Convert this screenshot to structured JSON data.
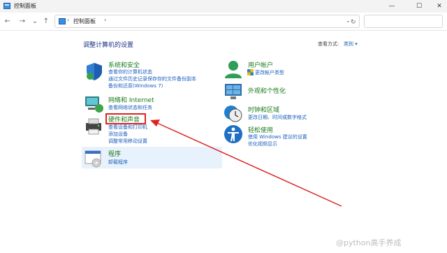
{
  "window": {
    "title": "控制面板",
    "minimize": "—",
    "maximize": "☐",
    "close": "✕"
  },
  "nav": {
    "back": "←",
    "forward": "→",
    "recent": "⌄",
    "up": "↑",
    "address": "控制面板",
    "address_sep": "›",
    "address_after": "›",
    "chevron": "⌄",
    "refresh": "↻",
    "search_placeholder": ""
  },
  "heading": "调整计算机的设置",
  "view_by": {
    "label": "查看方式:",
    "value": "类别 ▾"
  },
  "left_categories": [
    {
      "title": "系统和安全",
      "icon": "shield-icon",
      "links": [
        "查看你的计算机状态",
        "通过文件历史记录保存你的文件备份副本",
        "备份和还原(Windows 7)"
      ]
    },
    {
      "title": "网络和 Internet",
      "icon": "network-icon",
      "links": [
        "查看网络状态和任务"
      ]
    },
    {
      "title": "硬件和声音",
      "icon": "printer-icon",
      "links": [
        "查看设备和打印机",
        "添加设备",
        "调整常用移动设置"
      ]
    },
    {
      "title": "程序",
      "icon": "programs-icon",
      "links": [
        "卸载程序"
      ]
    }
  ],
  "right_categories": [
    {
      "title": "用户帐户",
      "icon": "user-icon",
      "links": [
        "更改帐户类型"
      ]
    },
    {
      "title": "外观和个性化",
      "icon": "appearance-icon",
      "links": []
    },
    {
      "title": "时钟和区域",
      "icon": "clock-icon",
      "links": [
        "更改日期、时间或数字格式"
      ]
    },
    {
      "title": "轻松使用",
      "icon": "accessibility-icon",
      "links": [
        "使用 Windows 建议的设置",
        "优化视频显示"
      ]
    }
  ],
  "watermark": "@python高手养成",
  "colors": {
    "category_title": "#1a7a1a",
    "link": "#1a5fbf",
    "heading": "#1e3287",
    "annotation": "#dd2222",
    "highlight_bg": "#e8f2fc"
  }
}
